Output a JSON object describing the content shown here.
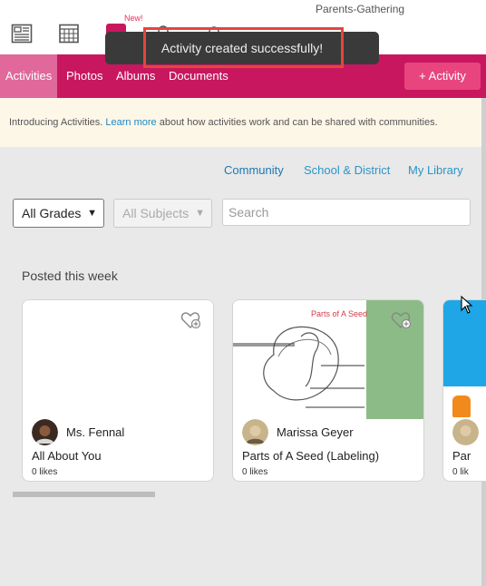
{
  "app": {
    "title": "Parents-Gathering"
  },
  "toolbar": {
    "new_badge": "New!"
  },
  "toast": {
    "message": "Activity created successfully!"
  },
  "nav": {
    "tabs": [
      {
        "label": "Activities",
        "active": true
      },
      {
        "label": "Photos"
      },
      {
        "label": "Albums"
      },
      {
        "label": "Documents"
      }
    ],
    "add_button": "+ Activity"
  },
  "banner": {
    "text_before": "Introducing Activities. ",
    "link": "Learn more",
    "text_after": " about how activities work and can be shared with communities."
  },
  "scope_tabs": [
    {
      "label": "Community",
      "active": true
    },
    {
      "label": "School & District"
    },
    {
      "label": "My Library"
    }
  ],
  "filters": {
    "grades": "All Grades",
    "subjects": "All Subjects",
    "search_placeholder": "Search"
  },
  "section": {
    "heading": "Posted this week"
  },
  "cards": [
    {
      "author": "Ms. Fennal",
      "title": "All About You",
      "likes": "0 likes"
    },
    {
      "author": "Marissa Geyer",
      "title": "Parts of A Seed (Labeling)",
      "likes": "0 likes",
      "thumb_text": "Parts of A Seed"
    },
    {
      "author": "",
      "title": "Par",
      "likes": "0 lik"
    }
  ],
  "colors": {
    "brand": "#c8175f",
    "link": "#2a95c8",
    "toast_border": "#e5453d"
  }
}
